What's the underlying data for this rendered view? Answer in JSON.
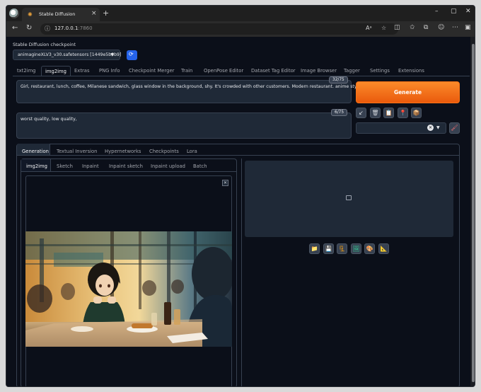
{
  "browser": {
    "tab_title": "Stable Diffusion",
    "url_host": "127.0.0.1",
    "url_port": ":7860",
    "win_minimize": "–",
    "win_maximize": "▢",
    "win_close": "✕"
  },
  "checkpoint": {
    "label": "Stable Diffusion checkpoint",
    "value": "animagineXLV3_v30.safetensors [1449e5b0b9]"
  },
  "main_tabs": [
    "txt2img",
    "img2img",
    "Extras",
    "PNG Info",
    "Checkpoint Merger",
    "Train",
    "OpenPose Editor",
    "Dataset Tag Editor",
    "Image Browser",
    "Tagger",
    "Settings",
    "Extensions"
  ],
  "main_tabs_active": "img2img",
  "prompt": {
    "text": "Girl, restaurant, lunch, coffee, Milanese sandwich, glass window in the background, shy. It's crowded with other customers. Modern restaurant. anime style",
    "tokens": "32/75"
  },
  "negative_prompt": {
    "text": "worst quality, low quality,",
    "tokens": "6/75"
  },
  "generate_label": "Generate",
  "tool_buttons": [
    "↙",
    "🗑",
    "📋",
    "📍",
    "📦"
  ],
  "styles_clear": "✕",
  "generation_tabs": [
    "Generation",
    "Textual Inversion",
    "Hypernetworks",
    "Checkpoints",
    "Lora"
  ],
  "generation_tabs_active": "Generation",
  "image_tabs": [
    "img2img",
    "Sketch",
    "Inpaint",
    "Inpaint sketch",
    "Inpaint upload",
    "Batch"
  ],
  "image_tabs_active": "img2img",
  "image_close": "✕",
  "output_buttons": [
    "📁",
    "💾",
    "🗜",
    "🖼",
    "🎨",
    "📐"
  ],
  "colors": {
    "background": "#0b0f19",
    "panel": "#1f2937",
    "border": "#374151",
    "generate": "#ea580c",
    "refresh": "#2563eb"
  }
}
